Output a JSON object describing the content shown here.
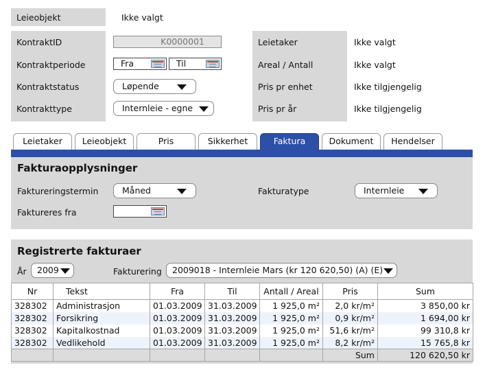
{
  "top": {
    "leieobjekt_label": "Leieobjekt",
    "leieobjekt_value": "Ikke valgt"
  },
  "contract": {
    "kontraktid_label": "KontraktID",
    "kontraktid_value": "K0000001",
    "periode_label": "Kontraktperiode",
    "fra_label": "Fra",
    "til_label": "Til",
    "status_label": "Kontraktstatus",
    "status_value": "Løpende",
    "type_label": "Kontrakttype",
    "type_value": "Internleie - egne"
  },
  "info": {
    "leietaker_label": "Leietaker",
    "leietaker_value": "Ikke valgt",
    "areal_label": "Areal / Antall",
    "areal_value": "Ikke valgt",
    "pris_enhet_label": "Pris pr enhet",
    "pris_enhet_value": "Ikke tilgjengelig",
    "pris_aar_label": "Pris pr år",
    "pris_aar_value": "Ikke tilgjengelig"
  },
  "tabs": [
    "Leietaker",
    "Leieobjekt",
    "Pris",
    "Sikkerhet",
    "Faktura",
    "Dokument",
    "Hendelser"
  ],
  "active_tab": "Faktura",
  "faktura": {
    "title": "Fakturaopplysninger",
    "termin_label": "Faktureringstermin",
    "termin_value": "Måned",
    "type_label": "Fakturatype",
    "type_value": "Internleie",
    "fra_label": "Faktureres fra"
  },
  "registered": {
    "title": "Registrerte fakturaer",
    "aar_label": "År",
    "aar_value": "2009",
    "fakturering_label": "Fakturering",
    "fakturering_value": "2009018 - Internleie Mars (kr 120 620,50) (A) (E)",
    "columns": [
      "Nr",
      "Tekst",
      "Fra",
      "Til",
      "Antall / Areal",
      "Pris",
      "Sum"
    ],
    "rows": [
      [
        "328302",
        "Administrasjon",
        "01.03.2009",
        "31.03.2009",
        "1 925,0 m²",
        "2,0 kr/m²",
        "3 850,00 kr"
      ],
      [
        "328302",
        "Forsikring",
        "01.03.2009",
        "31.03.2009",
        "1 925,0 m²",
        "0,9 kr/m²",
        "1 694,00 kr"
      ],
      [
        "328302",
        "Kapitalkostnad",
        "01.03.2009",
        "31.03.2009",
        "1 925,0 m²",
        "51,6 kr/m²",
        "99 310,8 kr"
      ],
      [
        "328302",
        "Vedlikehold",
        "01.03.2009",
        "31.03.2009",
        "1 925,0 m²",
        "8,2 kr/m²",
        "15 765,8 kr"
      ]
    ],
    "sum_label": "Sum",
    "sum_value": "120 620,50 kr"
  },
  "colors": {
    "panel_gray": "#d8d8d8",
    "tab_active": "#2c50a8",
    "tab_bar": "#2c50a8",
    "row_alt": "#eef3fb"
  },
  "icons": {
    "calendar": "calendar-icon",
    "dropdown": "chevron-down-icon"
  }
}
